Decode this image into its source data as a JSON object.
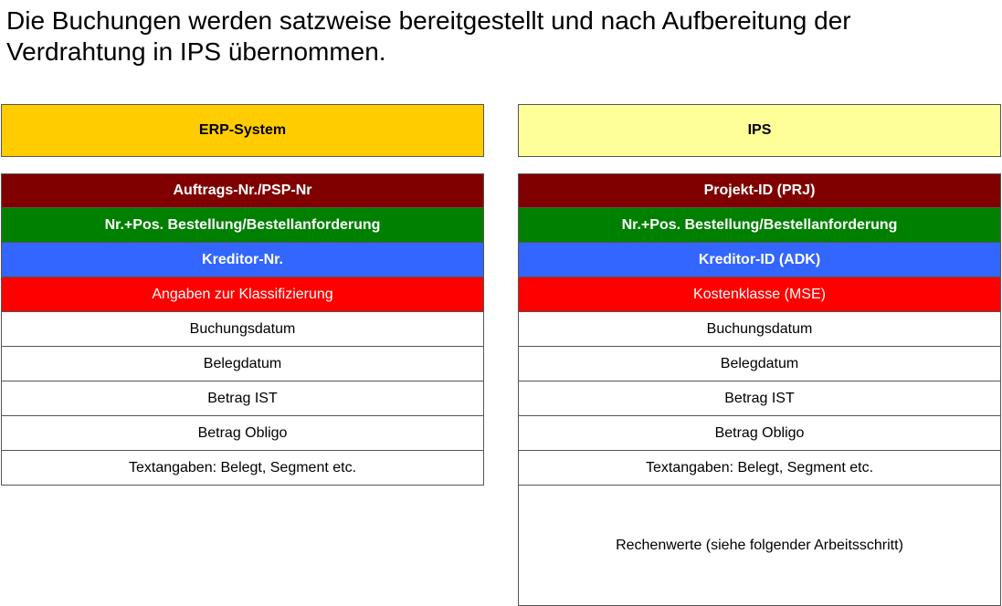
{
  "headline": "Die Buchungen werden satzweise bereitgestellt und nach Aufbereitung der Verdrahtung in IPS übernommen.",
  "colors": {
    "erp_header": "#FFCC00",
    "ips_header": "#FFFF99",
    "maroon": "#800000",
    "green": "#008000",
    "blue": "#3366FF",
    "red": "#FF0000",
    "white": "#FFFFFF"
  },
  "left": {
    "title": "ERP-System",
    "fields": [
      "Auftrags-Nr./PSP-Nr",
      "Nr.+Pos.  Bestellung/Bestellanforderung",
      "Kreditor-Nr.",
      "Angaben zur Klassifizierung",
      "Buchungsdatum",
      "Belegdatum",
      "Betrag IST",
      "Betrag Obligo",
      "Textangaben: Belegt, Segment etc."
    ]
  },
  "right": {
    "title": "IPS",
    "fields": [
      "Projekt-ID (PRJ)",
      "Nr.+Pos.  Bestellung/Bestellanforderung",
      "Kreditor-ID (ADK)",
      "Kostenklasse (MSE)",
      "Buchungsdatum",
      "Belegdatum",
      "Betrag IST",
      "Betrag Obligo",
      "Textangaben: Belegt, Segment etc.",
      "Rechenwerte (siehe folgender Arbeitsschritt)"
    ]
  }
}
